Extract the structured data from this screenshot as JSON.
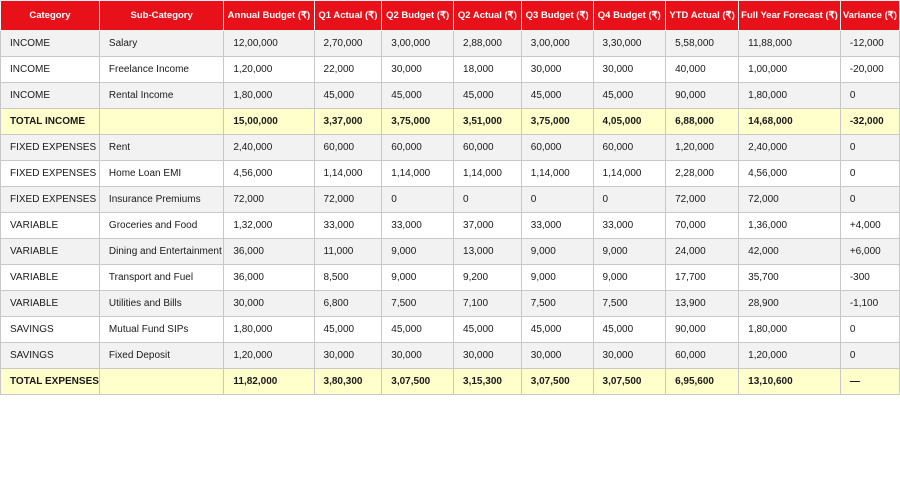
{
  "headers": [
    "Category",
    "Sub-Category",
    "Annual Budget (₹)",
    "Q1 Actual (₹)",
    "Q2 Budget (₹)",
    "Q2 Actual (₹)",
    "Q3 Budget (₹)",
    "Q4 Budget (₹)",
    "YTD Actual (₹)",
    "Full Year Forecast (₹)",
    "Variance (₹)"
  ],
  "rows": [
    {
      "type": "alt",
      "cells": [
        "INCOME",
        "Salary",
        "12,00,000",
        "2,70,000",
        "3,00,000",
        "2,88,000",
        "3,00,000",
        "3,30,000",
        "5,58,000",
        "11,88,000",
        "-12,000"
      ]
    },
    {
      "type": "plain",
      "cells": [
        "INCOME",
        "Freelance Income",
        "1,20,000",
        "22,000",
        "30,000",
        "18,000",
        "30,000",
        "30,000",
        "40,000",
        "1,00,000",
        "-20,000"
      ]
    },
    {
      "type": "alt",
      "cells": [
        "INCOME",
        "Rental Income",
        "1,80,000",
        "45,000",
        "45,000",
        "45,000",
        "45,000",
        "45,000",
        "90,000",
        "1,80,000",
        "0"
      ]
    },
    {
      "type": "total",
      "cells": [
        "TOTAL INCOME",
        "",
        "15,00,000",
        "3,37,000",
        "3,75,000",
        "3,51,000",
        "3,75,000",
        "4,05,000",
        "6,88,000",
        "14,68,000",
        "-32,000"
      ]
    },
    {
      "type": "alt",
      "cells": [
        "FIXED EXPENSES",
        "Rent",
        "2,40,000",
        "60,000",
        "60,000",
        "60,000",
        "60,000",
        "60,000",
        "1,20,000",
        "2,40,000",
        "0"
      ]
    },
    {
      "type": "plain",
      "cells": [
        "FIXED EXPENSES",
        "Home Loan EMI",
        "4,56,000",
        "1,14,000",
        "1,14,000",
        "1,14,000",
        "1,14,000",
        "1,14,000",
        "2,28,000",
        "4,56,000",
        "0"
      ]
    },
    {
      "type": "alt",
      "cells": [
        "FIXED EXPENSES",
        "Insurance Premiums",
        "72,000",
        "72,000",
        "0",
        "0",
        "0",
        "0",
        "72,000",
        "72,000",
        "0"
      ]
    },
    {
      "type": "plain",
      "cells": [
        "VARIABLE",
        "Groceries and Food",
        "1,32,000",
        "33,000",
        "33,000",
        "37,000",
        "33,000",
        "33,000",
        "70,000",
        "1,36,000",
        "+4,000"
      ]
    },
    {
      "type": "alt",
      "cells": [
        "VARIABLE",
        "Dining and Entertainment",
        "36,000",
        "11,000",
        "9,000",
        "13,000",
        "9,000",
        "9,000",
        "24,000",
        "42,000",
        "+6,000"
      ]
    },
    {
      "type": "plain",
      "cells": [
        "VARIABLE",
        "Transport and Fuel",
        "36,000",
        "8,500",
        "9,000",
        "9,200",
        "9,000",
        "9,000",
        "17,700",
        "35,700",
        "-300"
      ]
    },
    {
      "type": "alt",
      "cells": [
        "VARIABLE",
        "Utilities and Bills",
        "30,000",
        "6,800",
        "7,500",
        "7,100",
        "7,500",
        "7,500",
        "13,900",
        "28,900",
        "-1,100"
      ]
    },
    {
      "type": "plain",
      "cells": [
        "SAVINGS",
        "Mutual Fund SIPs",
        "1,80,000",
        "45,000",
        "45,000",
        "45,000",
        "45,000",
        "45,000",
        "90,000",
        "1,80,000",
        "0"
      ]
    },
    {
      "type": "alt",
      "cells": [
        "SAVINGS",
        "Fixed Deposit",
        "1,20,000",
        "30,000",
        "30,000",
        "30,000",
        "30,000",
        "30,000",
        "60,000",
        "1,20,000",
        "0"
      ]
    },
    {
      "type": "total",
      "cells": [
        "TOTAL EXPENSES",
        "",
        "11,82,000",
        "3,80,300",
        "3,07,500",
        "3,15,300",
        "3,07,500",
        "3,07,500",
        "6,95,600",
        "13,10,600",
        "—"
      ]
    }
  ]
}
